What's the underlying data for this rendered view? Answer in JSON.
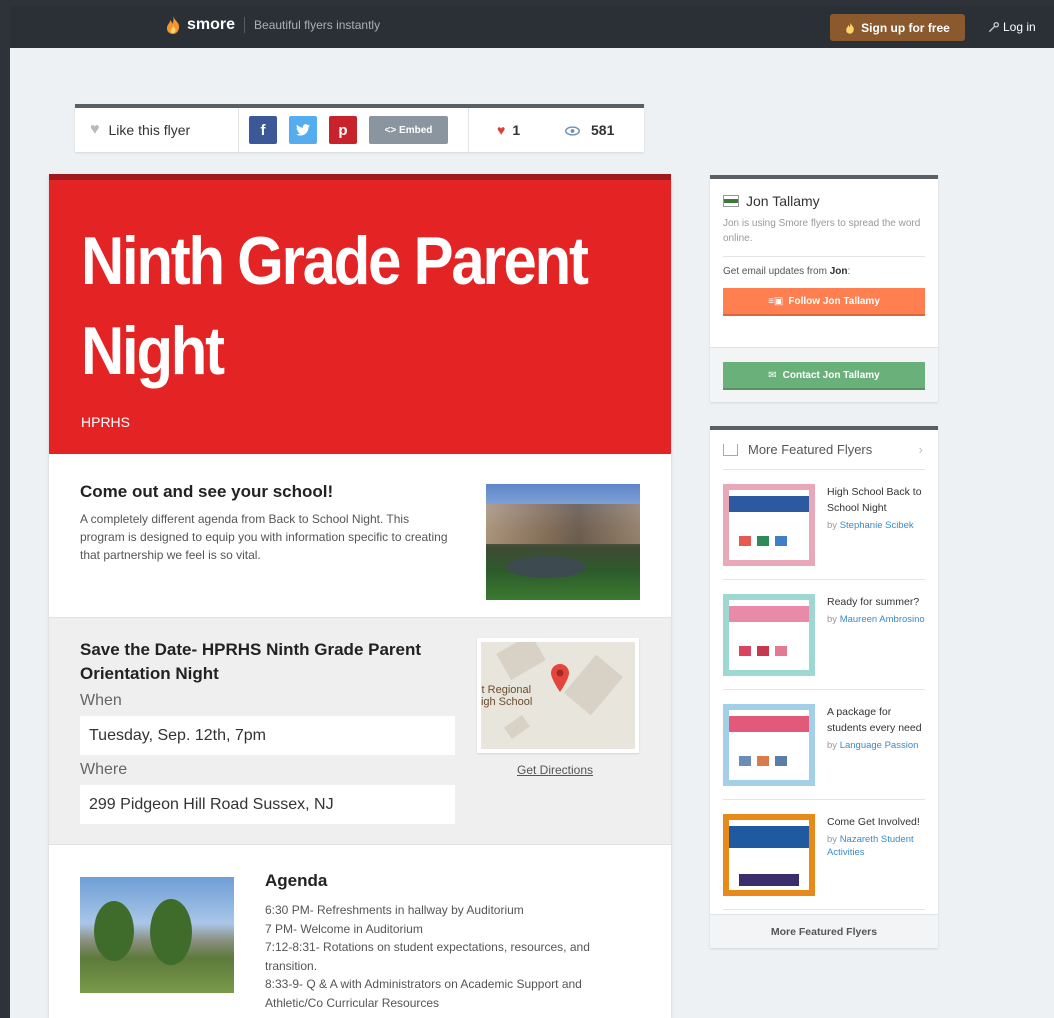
{
  "topbar": {
    "brand": "smore",
    "tagline": "Beautiful flyers instantly",
    "signup_label": "Sign up for free",
    "login_label": "Log in"
  },
  "sharebar": {
    "like_label": "Like this flyer",
    "facebook": "f",
    "twitter": "t",
    "pinterest": "p",
    "embed_label": "<> Embed",
    "likes_count": "1",
    "views_count": "581"
  },
  "flyer": {
    "title": "Ninth Grade Parent Night",
    "subtitle": "HPRHS",
    "intro": {
      "heading": "Come out and see your school!",
      "body": "A completely different agenda from Back to School Night. This program is designed to equip you with information specific to creating that partnership we feel is so vital."
    },
    "event": {
      "heading": "Save the Date- HPRHS Ninth Grade Parent Orientation Night",
      "when_label": "When",
      "when_value": "Tuesday, Sep. 12th, 7pm",
      "where_label": "Where",
      "where_value": "299 Pidgeon Hill Road Sussex, NJ",
      "map_label_line1": "int Regional",
      "map_label_line2": "High School",
      "directions_label": "Get Directions"
    },
    "agenda": {
      "title": "Agenda",
      "lines": [
        "6:30 PM- Refreshments in hallway by Auditorium",
        "7 PM- Welcome in Auditorium",
        "7:12-8:31- Rotations on student expectations, resources, and transition.",
        "8:33-9- Q & A with Administrators on Academic Support and Athletic/Co Curricular Resources"
      ]
    }
  },
  "sidebar": {
    "author_name": "Jon Tallamy",
    "author_desc": "Jon is using Smore flyers to spread the word online.",
    "updates_prefix": "Get email updates from ",
    "updates_name": "Jon",
    "updates_suffix": ":",
    "follow_label": "Follow Jon Tallamy",
    "contact_label": "Contact Jon Tallamy",
    "featured_heading": "More Featured Flyers",
    "featured": [
      {
        "title": "High School Back to School Night",
        "by": "by ",
        "author": "Stephanie Scibek",
        "color": "#e87a9a"
      },
      {
        "title": "Ready for summer?",
        "by": "by ",
        "author": "Maureen Ambrosino",
        "color": "#7cc7c0"
      },
      {
        "title": "A package for students every need",
        "by": "by ",
        "author": "Language Passion",
        "color": "#86c3e0"
      },
      {
        "title": "Come Get Involved!",
        "by": "by ",
        "author": "Nazareth Student Activities",
        "color": "#e88a1a"
      }
    ],
    "featured_footer": "More Featured Flyers"
  },
  "colors": {
    "hero_red": "#e42325",
    "follow_orange": "#ff7f50",
    "contact_green": "#6ab07a",
    "signup_brown": "#8a5a2e"
  }
}
